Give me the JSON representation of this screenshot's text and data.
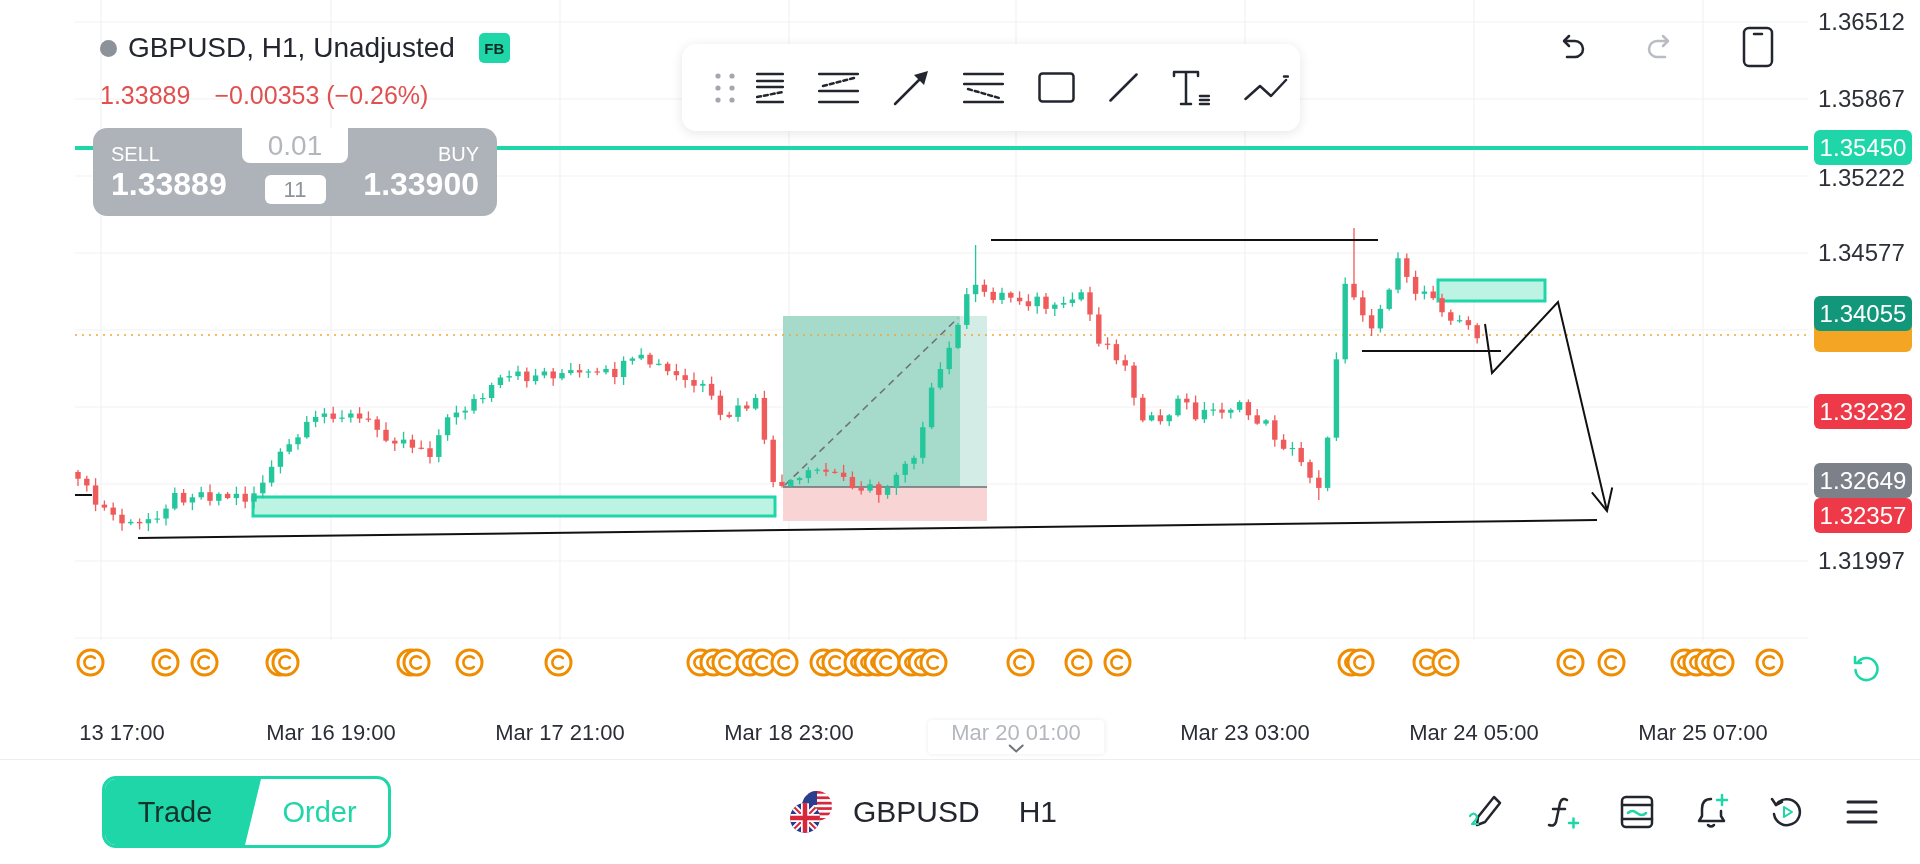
{
  "header": {
    "title": "GBPUSD, H1, Unadjusted",
    "badge": "FB",
    "last_price": "1.33889",
    "change": "−0.00353 (−0.26%)"
  },
  "trade_panel": {
    "sell_label": "SELL",
    "sell_price": "1.33889",
    "lot_size": "0.01",
    "spread": "11",
    "buy_label": "BUY",
    "buy_price": "1.33900"
  },
  "history": [
    {
      "kind": "undo",
      "disabled": false
    },
    {
      "kind": "redo",
      "disabled": true
    }
  ],
  "price_axis": {
    "labels": [
      "1.36512",
      "1.35867",
      "1.35222",
      "1.34577",
      "1.31997"
    ],
    "tags": [
      {
        "text": "1.35450",
        "color": "#1fd6a9"
      },
      {
        "text": "1.34055",
        "color": "#12977b"
      },
      {
        "color": "#f5a524"
      },
      {
        "text": "1.33232",
        "color": "#ee3a48"
      },
      {
        "text": "1.32649",
        "color": "#7c8089"
      },
      {
        "text": "1.32357",
        "color": "#ee3a48"
      }
    ]
  },
  "time_axis": {
    "labels": [
      {
        "text": "13 17:00",
        "dimmed": false
      },
      {
        "text": "Mar 16 19:00",
        "dimmed": false
      },
      {
        "text": "Mar 17 21:00",
        "dimmed": false
      },
      {
        "text": "Mar 18 23:00",
        "dimmed": false
      },
      {
        "text": "Mar 20 01:00",
        "dimmed": true
      },
      {
        "text": "Mar 23 03:00",
        "dimmed": false
      },
      {
        "text": "Mar 24 05:00",
        "dimmed": false
      },
      {
        "text": "Mar 25 07:00",
        "dimmed": false
      }
    ]
  },
  "bottom_bar": {
    "mode_tabs": [
      {
        "label": "Trade",
        "selected": true
      },
      {
        "label": "Order",
        "selected": false
      }
    ],
    "symbol": "GBPUSD",
    "timeframe": "H1"
  }
}
